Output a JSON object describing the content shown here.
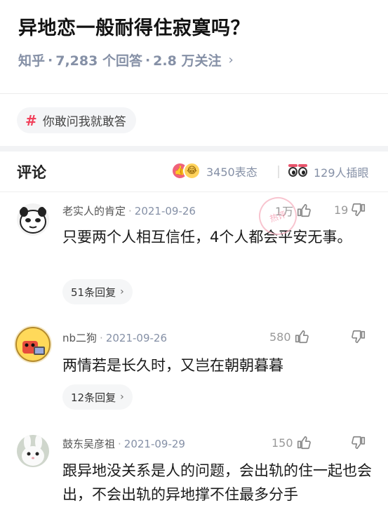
{
  "question": {
    "title": "异地恋一般耐得住寂寞吗？",
    "source": "知乎",
    "answers": "7,283 个回答",
    "followers": "2.8 万关注"
  },
  "topic_tag": {
    "label": "你敢问我就敢答"
  },
  "comments_section": {
    "title": "评论",
    "reaction_count": "3450表态",
    "peek_count": "129人插眼"
  },
  "stamp": {
    "text": "热评"
  },
  "comments": [
    {
      "author": "老实人的肯定",
      "date": "2021-09-26",
      "likes": "1万",
      "dislikes": "19",
      "text": "只要两个人相互信任，4个人都会平安无事。",
      "replies": "51条回复"
    },
    {
      "author": "nb二狗",
      "date": "2021-09-26",
      "likes": "580",
      "dislikes": "",
      "text": "两情若是长久时，又岂在朝朝暮暮",
      "replies": "12条回复"
    },
    {
      "author": "鼓东吴彦祖",
      "date": "2021-09-29",
      "likes": "150",
      "dislikes": "",
      "text": "跟异地没关系是人的问题，会出轨的住一起也会出，不会出轨的异地撑不住最多分手",
      "replies": ""
    }
  ],
  "colors": {
    "accent": "#f1405a",
    "meta_gray": "#8590a6",
    "band": "#f2f3f5"
  }
}
